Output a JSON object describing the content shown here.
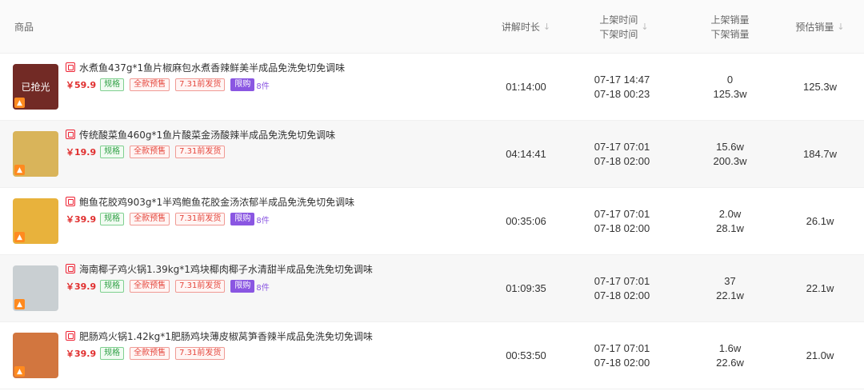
{
  "header": {
    "product": "商品",
    "duration": "讲解时长",
    "listed_time": "上架时间",
    "delisted_time": "下架时间",
    "listed_sales": "上架销量",
    "delisted_sales": "下架销量",
    "estimated_sales": "预估销量",
    "sort_icon": "↓"
  },
  "thumb_sold_text": "已抢光",
  "rows": [
    {
      "title": "水煮鱼437g*1鱼片椒麻包水煮香辣鲜美半成品免洗免切免调味",
      "price": "￥59.9",
      "tags": [
        "规格",
        "全款预售",
        "7.31前发货"
      ],
      "limit_label": "限购",
      "limit_count": "8件",
      "duration": "01:14:00",
      "listed_at": "07-17 14:47",
      "delisted_at": "07-18 00:23",
      "listed_sales": "0",
      "delisted_sales": "125.3w",
      "estimated_sales": "125.3w",
      "sold_out": true,
      "thumb_color": "#b0413a"
    },
    {
      "title": "传统酸菜鱼460g*1鱼片酸菜金汤酸辣半成品免洗免切免调味",
      "price": "￥19.9",
      "tags": [
        "规格",
        "全款预售",
        "7.31前发货"
      ],
      "limit_label": "",
      "limit_count": "",
      "duration": "04:14:41",
      "listed_at": "07-17 07:01",
      "delisted_at": "07-18 02:00",
      "listed_sales": "15.6w",
      "delisted_sales": "200.3w",
      "estimated_sales": "184.7w",
      "sold_out": false,
      "thumb_color": "#d9b45a"
    },
    {
      "title": "鲍鱼花胶鸡903g*1半鸡鲍鱼花胶金汤浓郁半成品免洗免切免调味",
      "price": "￥39.9",
      "tags": [
        "规格",
        "全款预售",
        "7.31前发货"
      ],
      "limit_label": "限购",
      "limit_count": "8件",
      "duration": "00:35:06",
      "listed_at": "07-17 07:01",
      "delisted_at": "07-18 02:00",
      "listed_sales": "2.0w",
      "delisted_sales": "28.1w",
      "estimated_sales": "26.1w",
      "sold_out": false,
      "thumb_color": "#e8b23c"
    },
    {
      "title": "海南椰子鸡火锅1.39kg*1鸡块椰肉椰子水清甜半成品免洗免切免调味",
      "price": "￥39.9",
      "tags": [
        "规格",
        "全款预售",
        "7.31前发货"
      ],
      "limit_label": "限购",
      "limit_count": "8件",
      "duration": "01:09:35",
      "listed_at": "07-17 07:01",
      "delisted_at": "07-18 02:00",
      "listed_sales": "37",
      "delisted_sales": "22.1w",
      "estimated_sales": "22.1w",
      "sold_out": false,
      "thumb_color": "#c9cfd2"
    },
    {
      "title": "肥肠鸡火锅1.42kg*1肥肠鸡块薄皮椒莴笋香辣半成品免洗免切免调味",
      "price": "￥39.9",
      "tags": [
        "规格",
        "全款预售",
        "7.31前发货"
      ],
      "limit_label": "",
      "limit_count": "",
      "duration": "00:53:50",
      "listed_at": "07-17 07:01",
      "delisted_at": "07-18 02:00",
      "listed_sales": "1.6w",
      "delisted_sales": "22.6w",
      "estimated_sales": "21.0w",
      "sold_out": false,
      "thumb_color": "#d2763f"
    }
  ]
}
